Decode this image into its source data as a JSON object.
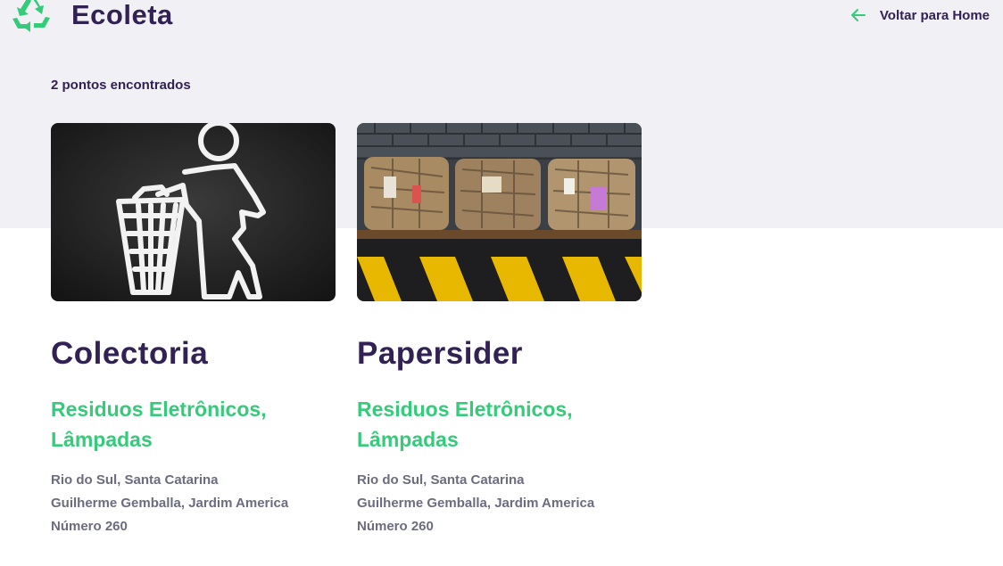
{
  "header": {
    "brand": "Ecoleta",
    "back_label": "Voltar para Home"
  },
  "results": {
    "count_text": "2 pontos encontrados"
  },
  "points": [
    {
      "name": "Colectoria",
      "items": "Residuos Eletrônicos, Lâmpadas",
      "city_state": "Rio do Sul, Santa Catarina",
      "street": "Guilherme Gemballa, Jardim America",
      "number": "Número 260",
      "image": "trash-can-chalk-drawing"
    },
    {
      "name": "Papersider",
      "items": "Residuos Eletrônicos, Lâmpadas",
      "city_state": "Rio do Sul, Santa Catarina",
      "street": "Guilherme Gemballa, Jardim America",
      "number": "Número 260",
      "image": "cardboard-bales"
    }
  ],
  "colors": {
    "primary": "#322153",
    "accent": "#34cb79",
    "muted": "#6c6c80",
    "band": "#f0f0f5"
  }
}
